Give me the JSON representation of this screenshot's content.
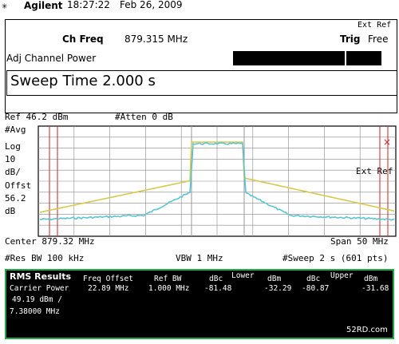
{
  "header": {
    "logo_glyph": "✳",
    "brand": "Agilent",
    "time": "18:27:22",
    "date": "Feb 26, 2009"
  },
  "info": {
    "ext_ref": "Ext Ref",
    "ch_freq_label": "Ch Freq",
    "ch_freq_value": "879.315 MHz",
    "trig_label": "Trig",
    "trig_value": "Free",
    "mode": "Adj Channel Power",
    "entry_value": "Sweep Time 2.000  s"
  },
  "screen": {
    "ref_level": "Ref 46.2 dBm",
    "attenuation": "#Atten 0 dB",
    "y_labels": [
      "#Avg",
      "Log",
      "10",
      "dB/",
      "Offst",
      "56.2",
      "dB"
    ],
    "x_marker": "×",
    "ext_ref": "Ext Ref",
    "center": "Center 879.32 MHz",
    "span": "Span 50 MHz",
    "res_bw": "#Res BW 100 kHz",
    "vbw": "VBW 1 MHz",
    "sweep": "#Sweep 2 s (601 pts)"
  },
  "results": {
    "title": "RMS Results",
    "h_freq_offset": "Freq Offset",
    "h_ref_bw": "Ref BW",
    "h_dbc1": "dBc",
    "h_lower": "Lower",
    "h_dbm1": "dBm",
    "h_dbc2": "dBc",
    "h_upper": "Upper",
    "h_dbm2": "dBm",
    "carrier_label": "Carrier Power",
    "freq_offset": "22.89 MHz",
    "ref_bw": "1.000 MHz",
    "lower_dbc": "-81.48",
    "lower_dbm": "-32.29",
    "upper_dbc": "-80.87",
    "upper_dbm": "-31.68",
    "carrier_power": "49.19 dBm /",
    "carrier_bw": "7.38000 MHz",
    "watermark": "52RD.com"
  },
  "colors": {
    "trace_yellow": "#d8c84a",
    "trace_cyan": "#5cc4d4",
    "marker_red": "#cc2222",
    "panel_border": "#22aa44"
  }
}
